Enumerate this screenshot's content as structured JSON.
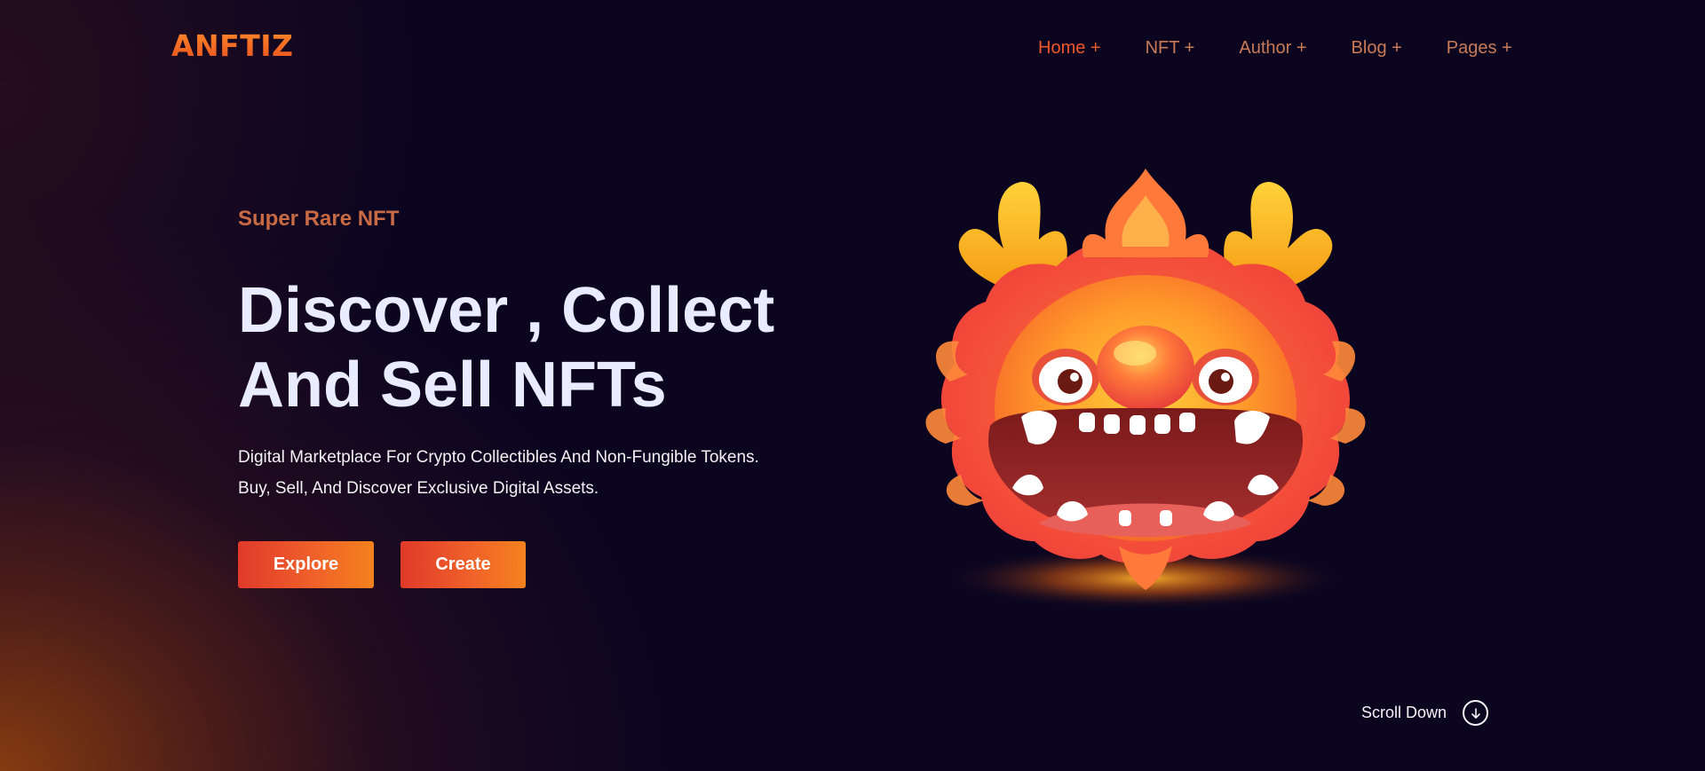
{
  "brand": {
    "logo_text": "ANFTIZ"
  },
  "nav": {
    "items": [
      {
        "label": "Home +",
        "active": true
      },
      {
        "label": "NFT +"
      },
      {
        "label": "Author +"
      },
      {
        "label": "Blog +"
      },
      {
        "label": "Pages +"
      }
    ]
  },
  "hero": {
    "eyebrow": "Super Rare NFT",
    "headline_line1": "Discover , Collect",
    "headline_line2": "And Sell NFTs",
    "subtext_line1": "Digital Marketplace For Crypto Collectibles And Non-Fungible Tokens.",
    "subtext_line2": "Buy, Sell, And Discover Exclusive Digital Assets.",
    "explore_label": "Explore",
    "create_label": "Create"
  },
  "scroll": {
    "label": "Scroll Down",
    "icon": "arrow-down-circle-icon"
  },
  "colors": {
    "accent": "#f0582a",
    "nav_text": "#c97a56",
    "headline": "#e9ecff",
    "background": "#0b0520"
  }
}
